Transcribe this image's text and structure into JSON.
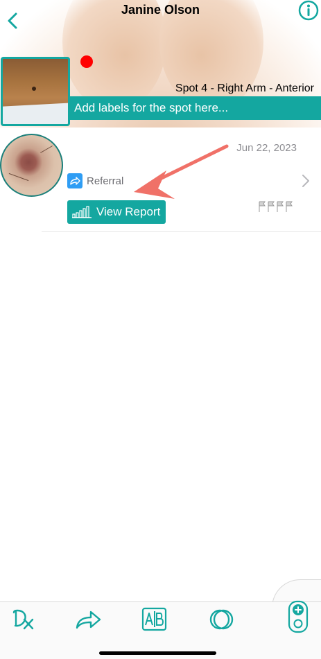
{
  "header": {
    "patient_name": "Janine Olson",
    "spot_label": "Spot 4 - Right Arm - Anterior",
    "labels_placeholder": "Add labels for the spot here..."
  },
  "entry": {
    "date": "Jun 22, 2023",
    "referral_label": "Referral",
    "view_report_label": "View Report"
  },
  "tabbar": {
    "items": [
      "dx-icon",
      "share-icon",
      "ab-compare-icon",
      "overlap-circles-icon",
      "add-dermatoscope-icon"
    ]
  },
  "colors": {
    "accent": "#14a7a0",
    "marker": "#ff0000",
    "referral_icon": "#2f9df4",
    "annotation_arrow": "#f07168"
  }
}
